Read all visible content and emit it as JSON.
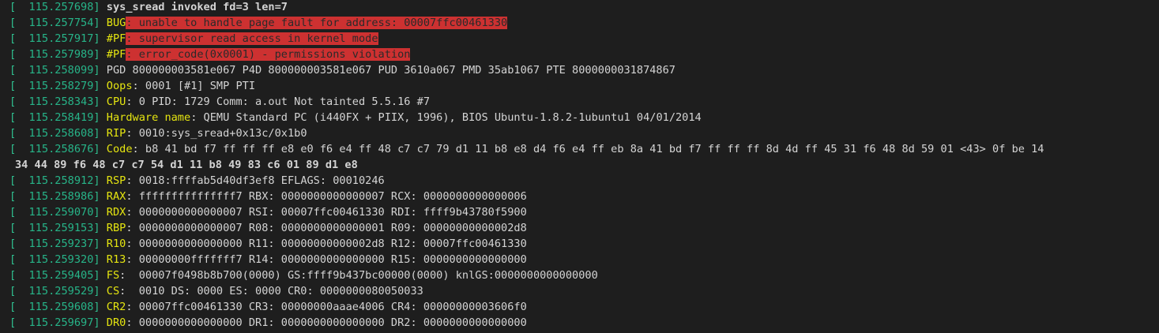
{
  "colors": {
    "background": "#1e1e1e",
    "timestamp": "#27b589",
    "label": "#e5e510",
    "text": "#d4d4d4",
    "error_highlight": "#cd3131"
  },
  "lines": [
    {
      "ts": "115.257698",
      "label": "",
      "text": "sys_sread invoked fd=3 len=7",
      "bold": true,
      "highlight": false
    },
    {
      "ts": "115.257754",
      "label": "BUG",
      "text": ": unable to handle page fault for address: 00007ffc00461330",
      "highlight": true
    },
    {
      "ts": "115.257917",
      "label": "#PF",
      "text": ": supervisor read access in kernel mode",
      "highlight": true
    },
    {
      "ts": "115.257989",
      "label": "#PF",
      "text": ": error_code(0x0001) - permissions violation",
      "highlight": true
    },
    {
      "ts": "115.258099",
      "label": "",
      "text": "PGD 800000003581e067 P4D 800000003581e067 PUD 3610a067 PMD 35ab1067 PTE 8000000031874867",
      "highlight": false
    },
    {
      "ts": "115.258279",
      "label": "Oops",
      "text": ": 0001 [#1] SMP PTI",
      "highlight": false
    },
    {
      "ts": "115.258343",
      "label": "CPU",
      "text": ": 0 PID: 1729 Comm: a.out Not tainted 5.5.16 #7",
      "highlight": false
    },
    {
      "ts": "115.258419",
      "label": "Hardware name",
      "text": ": QEMU Standard PC (i440FX + PIIX, 1996), BIOS Ubuntu-1.8.2-1ubuntu1 04/01/2014",
      "highlight": false
    },
    {
      "ts": "115.258608",
      "label": "RIP",
      "text": ": 0010:sys_sread+0x13c/0x1b0",
      "highlight": false
    },
    {
      "ts": "115.258676",
      "label": "Code",
      "text": ": b8 41 bd f7 ff ff ff e8 e0 f6 e4 ff 48 c7 c7 79 d1 11 b8 e8 d4 f6 e4 ff eb 8a 41 bd f7 ff ff ff 8d 4d ff 45 31 f6 48 8d 59 01 <43> 0f be 14",
      "highlight": false
    },
    {
      "continuation": "34 44 89 f6 48 c7 c7 54 d1 11 b8 49 83 c6 01 89 d1 e8"
    },
    {
      "ts": "115.258912",
      "label": "RSP",
      "text": ": 0018:ffffab5d40df3ef8 EFLAGS: 00010246",
      "highlight": false
    },
    {
      "ts": "115.258986",
      "label": "RAX",
      "text": ": fffffffffffffff7 RBX: 0000000000000007 RCX: 0000000000000006",
      "highlight": false
    },
    {
      "ts": "115.259070",
      "label": "RDX",
      "text": ": 0000000000000007 RSI: 00007ffc00461330 RDI: ffff9b43780f5900",
      "highlight": false
    },
    {
      "ts": "115.259153",
      "label": "RBP",
      "text": ": 0000000000000007 R08: 0000000000000001 R09: 00000000000002d8",
      "highlight": false
    },
    {
      "ts": "115.259237",
      "label": "R10",
      "text": ": 0000000000000000 R11: 00000000000002d8 R12: 00007ffc00461330",
      "highlight": false
    },
    {
      "ts": "115.259320",
      "label": "R13",
      "text": ": 00000000fffffff7 R14: 0000000000000000 R15: 0000000000000000",
      "highlight": false
    },
    {
      "ts": "115.259405",
      "label": "FS",
      "text": ":  00007f0498b8b700(0000) GS:ffff9b437bc00000(0000) knlGS:0000000000000000",
      "highlight": false
    },
    {
      "ts": "115.259529",
      "label": "CS",
      "text": ":  0010 DS: 0000 ES: 0000 CR0: 0000000080050033",
      "highlight": false
    },
    {
      "ts": "115.259608",
      "label": "CR2",
      "text": ": 00007ffc00461330 CR3: 00000000aaae4006 CR4: 00000000003606f0",
      "highlight": false
    },
    {
      "ts": "115.259697",
      "label": "DR0",
      "text": ": 0000000000000000 DR1: 0000000000000000 DR2: 0000000000000000",
      "highlight": false
    }
  ]
}
